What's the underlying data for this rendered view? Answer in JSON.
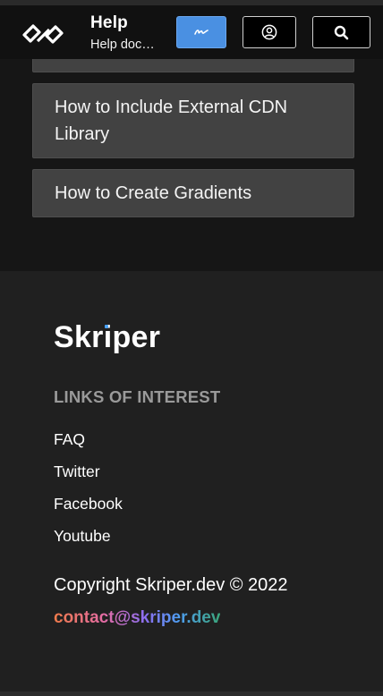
{
  "header": {
    "title": "Help",
    "subtitle": "Help doc…"
  },
  "cards": [
    {
      "label": ""
    },
    {
      "label": "How to Include External CDN Library"
    },
    {
      "label": "How to Create Gradients"
    }
  ],
  "footer": {
    "brand": "Skriper",
    "links_heading": "LINKS OF INTEREST",
    "links": [
      "FAQ",
      "Twitter",
      "Facebook",
      "Youtube"
    ],
    "copyright": "Copyright Skriper.dev © 2022",
    "email": "contact@skriper.dev"
  },
  "colors": {
    "accent_blue": "#4a90e2",
    "card_bg": "#424242",
    "footer_bg": "#202020"
  }
}
